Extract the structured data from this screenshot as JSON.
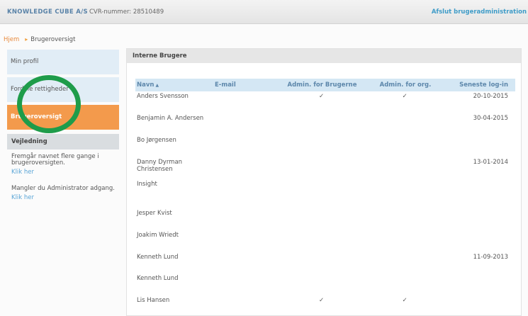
{
  "header": {
    "company": "KNOWLEDGE CUBE A/S",
    "cvr": "CVR-nummer: 28510489",
    "logout_link": "Afslut brugeradministration"
  },
  "breadcrumb": {
    "home": "Hjem",
    "current": "Brugeroversigt"
  },
  "sidebar": {
    "items": [
      {
        "label": "Min profil"
      },
      {
        "label": "Fordele rettigheder"
      },
      {
        "label": "Brugeroversigt"
      }
    ],
    "guide": {
      "title": "Vejledning",
      "blocks": [
        {
          "text": "Fremgår navnet flere gange i brugeroversigten.",
          "link": "Klik her"
        },
        {
          "text": "Mangler du Administrator adgang.",
          "link": "Klik her"
        }
      ]
    }
  },
  "panel": {
    "title": "Interne Brugere",
    "columns": [
      "Navn",
      "E-mail",
      "Admin. for Brugerne",
      "Admin. for org.",
      "Seneste log-in"
    ],
    "sort_icon": "▲",
    "check_glyph": "✓",
    "rows": [
      {
        "name": "Anders Svensson",
        "email": "",
        "admin_users": "✓",
        "admin_org": "✓",
        "last_login": "20-10-2015"
      },
      {
        "name": "Benjamin A. Andersen",
        "email": "",
        "admin_users": "",
        "admin_org": "",
        "last_login": "30-04-2015"
      },
      {
        "name": "Bo Jørgensen",
        "email": "",
        "admin_users": "",
        "admin_org": "",
        "last_login": ""
      },
      {
        "name": "Danny Dyrman Christensen",
        "email": "",
        "admin_users": "",
        "admin_org": "",
        "last_login": "13-01-2014"
      },
      {
        "name": "Insight",
        "email": "",
        "admin_users": "",
        "admin_org": "",
        "last_login": ""
      },
      {
        "name": "Jesper Kvist",
        "email": "",
        "admin_users": "",
        "admin_org": "",
        "last_login": ""
      },
      {
        "name": "Joakim Wriedt",
        "email": "",
        "admin_users": "",
        "admin_org": "",
        "last_login": ""
      },
      {
        "name": "Kenneth Lund",
        "email": "",
        "admin_users": "",
        "admin_org": "",
        "last_login": "11-09-2013"
      },
      {
        "name": "Kenneth Lund",
        "email": "",
        "admin_users": "",
        "admin_org": "",
        "last_login": ""
      },
      {
        "name": "Lis Hansen",
        "email": "",
        "admin_users": "✓",
        "admin_org": "✓",
        "last_login": ""
      }
    ]
  },
  "colors": {
    "accent_orange": "#f39a4c",
    "highlight_green": "#1e9c4a",
    "header_blue": "#5a83a8",
    "link_blue": "#3f9cc8"
  }
}
